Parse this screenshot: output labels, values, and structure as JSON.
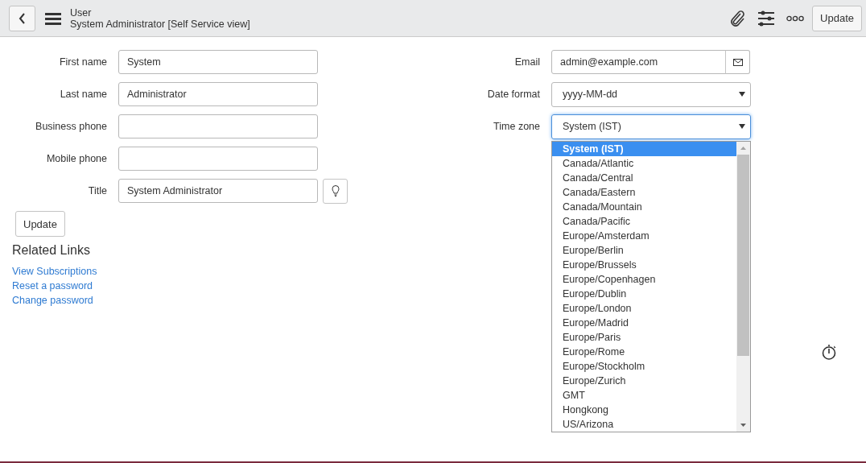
{
  "header": {
    "title": "User",
    "subtitle": "System Administrator [Self Service view]",
    "update_button": "Update"
  },
  "left_fields": [
    {
      "label": "First name",
      "kind": "text",
      "value": "System"
    },
    {
      "label": "Last name",
      "kind": "text",
      "value": "Administrator"
    },
    {
      "label": "Business phone",
      "kind": "text"
    },
    {
      "label": "Mobile phone",
      "kind": "text"
    },
    {
      "label": "Title",
      "kind": "text-suggest",
      "value": "System Administrator"
    }
  ],
  "right_fields": [
    {
      "label": "Email",
      "kind": "email",
      "value": "admin@example.com"
    },
    {
      "label": "Date format",
      "kind": "select",
      "value": "yyyy-MM-dd"
    },
    {
      "label": "Time zone",
      "kind": "select",
      "value": "System (IST)",
      "focused": true,
      "expanded": true
    }
  ],
  "timezone_options": [
    {
      "label": "System (IST)",
      "selected": true
    },
    {
      "label": "Canada/Atlantic",
      "selected": false
    },
    {
      "label": "Canada/Central",
      "selected": false
    },
    {
      "label": "Canada/Eastern",
      "selected": false
    },
    {
      "label": "Canada/Mountain",
      "selected": false
    },
    {
      "label": "Canada/Pacific",
      "selected": false
    },
    {
      "label": "Europe/Amsterdam",
      "selected": false
    },
    {
      "label": "Europe/Berlin",
      "selected": false
    },
    {
      "label": "Europe/Brussels",
      "selected": false
    },
    {
      "label": "Europe/Copenhagen",
      "selected": false
    },
    {
      "label": "Europe/Dublin",
      "selected": false
    },
    {
      "label": "Europe/London",
      "selected": false
    },
    {
      "label": "Europe/Madrid",
      "selected": false
    },
    {
      "label": "Europe/Paris",
      "selected": false
    },
    {
      "label": "Europe/Rome",
      "selected": false
    },
    {
      "label": "Europe/Stockholm",
      "selected": false
    },
    {
      "label": "Europe/Zurich",
      "selected": false
    },
    {
      "label": "GMT",
      "selected": false
    },
    {
      "label": "Hongkong",
      "selected": false
    },
    {
      "label": "US/Arizona",
      "selected": false
    }
  ],
  "form_update_button": "Update",
  "related_links": {
    "title": "Related Links",
    "links": [
      "View Subscriptions",
      "Reset a password",
      "Change password"
    ]
  }
}
